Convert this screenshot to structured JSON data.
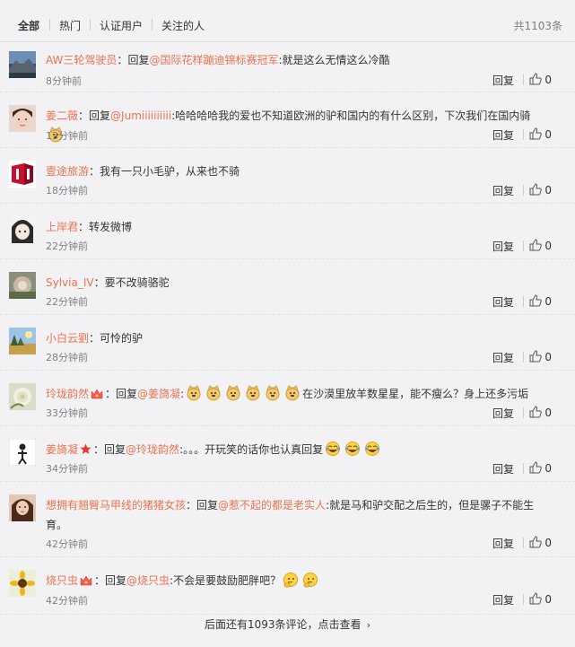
{
  "tabs": [
    "全部",
    "热门",
    "认证用户",
    "关注的人"
  ],
  "total": "共1103条",
  "reply_label": "回复",
  "comments": [
    {
      "user": "AW三轮驾驶员",
      "colon": "：",
      "reply_prefix": "回复",
      "mention": "@国际花样蹦迪锦标赛冠军",
      "text": ":就是这么无情这么冷酷",
      "time": "8分钟前",
      "likes": "0",
      "avatar": "mountain-avatar"
    },
    {
      "user": "姜二薇",
      "colon": "：",
      "reply_prefix": "回复",
      "mention": "@Jumiiiiiiiiii",
      "text": ":哈哈哈哈我的爱也不知道欧洲的驴和国内的有什么区别，下次我们在国内骑",
      "time": "13分钟前",
      "likes": "0",
      "avatar": "girl-avatar"
    },
    {
      "user": "壹途旅游",
      "colon": "：",
      "reply_prefix": "",
      "mention": "",
      "text": "我有一只小毛驴，从来也不骑",
      "time": "18分钟前",
      "likes": "0",
      "avatar": "logo-avatar"
    },
    {
      "user": "上岸君",
      "colon": "：",
      "reply_prefix": "",
      "mention": "",
      "text": "转发微博",
      "time": "22分钟前",
      "likes": "0",
      "avatar": "anime-avatar"
    },
    {
      "user": "Sylvia_IV",
      "colon": "：",
      "reply_prefix": "",
      "mention": "",
      "text": "要不改骑骆驼",
      "time": "22分钟前",
      "likes": "0",
      "avatar": "flower-avatar"
    },
    {
      "user": "小白云劉",
      "colon": "：",
      "reply_prefix": "",
      "mention": "",
      "text": "可怜的驴",
      "time": "28分钟前",
      "likes": "0",
      "avatar": "landscape-avatar"
    },
    {
      "user": "玲珑韵然",
      "colon": "：",
      "reply_prefix": "回复",
      "mention": "@姜旖凝",
      "text": "在沙漠里放羊数星星，能不瘦么？身上还多污垢",
      "time": "33分钟前",
      "likes": "0",
      "avatar": "rose-avatar"
    },
    {
      "user": "姜旖凝",
      "colon": "：",
      "reply_prefix": "回复",
      "mention": "@玲珑韵然",
      "text": "。。。开玩笑的话你也认真回复",
      "time": "34分钟前",
      "likes": "0",
      "avatar": "figure-avatar"
    },
    {
      "user": "想拥有翘臀马甲线的猪猪女孩",
      "colon": "：",
      "reply_prefix": "回复",
      "mention": "@惹不起的都是老实人",
      "text": ":就是马和驴交配之后生的，但是骡子不能生育。",
      "time": "42分钟前",
      "likes": "0",
      "avatar": "woman-avatar"
    },
    {
      "user": "烧只虫",
      "colon": "：",
      "reply_prefix": "回复",
      "mention": "@烧只虫",
      "text": ":不会是要鼓励肥胖吧？",
      "time": "42分钟前",
      "likes": "0",
      "avatar": "sunflower-avatar"
    }
  ],
  "more_text": "后面还有1093条评论，点击查看",
  "colors": {
    "accent": "#eb7350",
    "text": "#333333",
    "muted": "#808080",
    "background": "#f2f2f5"
  }
}
